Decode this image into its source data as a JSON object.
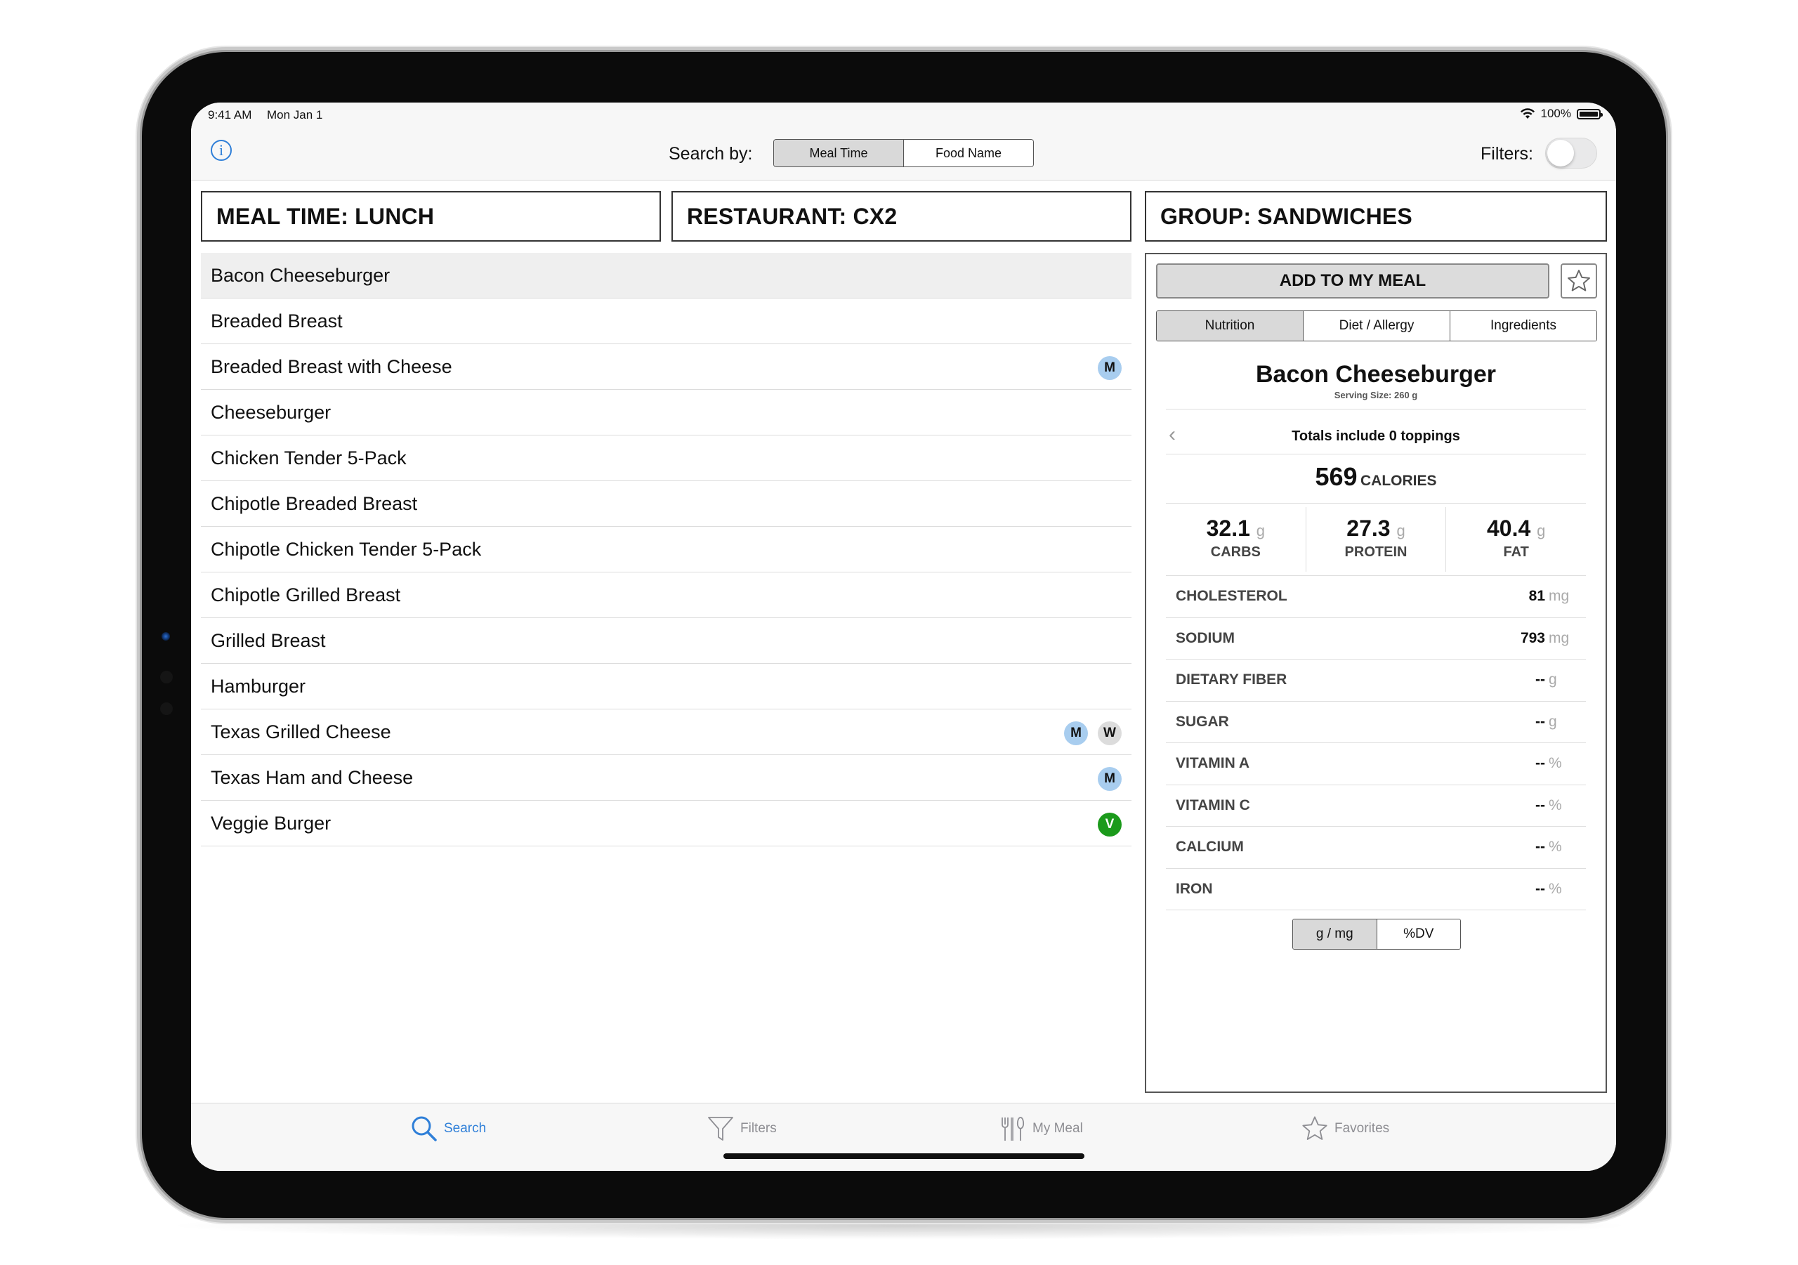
{
  "status_bar": {
    "time": "9:41 AM",
    "date": "Mon Jan 1",
    "battery": "100%"
  },
  "nav": {
    "search_by_label": "Search by:",
    "search_options": [
      "Meal Time",
      "Food Name"
    ],
    "selected_search_option": "Meal Time",
    "filters_label": "Filters:",
    "filters_enabled": false
  },
  "headers": {
    "meal_time": "MEAL TIME: LUNCH",
    "restaurant": "RESTAURANT: CX2",
    "group": "GROUP: SANDWICHES"
  },
  "food_list": [
    {
      "name": "Bacon Cheeseburger",
      "badges": [],
      "selected": true
    },
    {
      "name": "Breaded Breast",
      "badges": []
    },
    {
      "name": "Breaded Breast with Cheese",
      "badges": [
        "M"
      ]
    },
    {
      "name": "Cheeseburger",
      "badges": []
    },
    {
      "name": "Chicken Tender 5-Pack",
      "badges": []
    },
    {
      "name": "Chipotle Breaded Breast",
      "badges": []
    },
    {
      "name": "Chipotle Chicken Tender 5-Pack",
      "badges": []
    },
    {
      "name": "Chipotle Grilled Breast",
      "badges": []
    },
    {
      "name": "Grilled Breast",
      "badges": []
    },
    {
      "name": "Hamburger",
      "badges": []
    },
    {
      "name": "Texas Grilled Cheese",
      "badges": [
        "M",
        "W"
      ]
    },
    {
      "name": "Texas Ham and Cheese",
      "badges": [
        "M"
      ]
    },
    {
      "name": "Veggie Burger",
      "badges": [
        "V"
      ]
    }
  ],
  "detail": {
    "add_button": "ADD TO MY MEAL",
    "tabs": [
      "Nutrition",
      "Diet / Allergy",
      "Ingredients"
    ],
    "selected_tab": "Nutrition",
    "food_title": "Bacon Cheeseburger",
    "serving_size": "Serving Size: 260 g",
    "toppings": "Totals include 0 toppings",
    "calories": "569",
    "calories_label": "CALORIES",
    "macros": [
      {
        "value": "32.1",
        "unit": "g",
        "label": "CARBS"
      },
      {
        "value": "27.3",
        "unit": "g",
        "label": "PROTEIN"
      },
      {
        "value": "40.4",
        "unit": "g",
        "label": "FAT"
      }
    ],
    "nutrients": [
      {
        "name": "CHOLESTEROL",
        "value": "81",
        "unit": "mg"
      },
      {
        "name": "SODIUM",
        "value": "793",
        "unit": "mg"
      },
      {
        "name": "DIETARY FIBER",
        "value": "--",
        "unit": "g"
      },
      {
        "name": "SUGAR",
        "value": "--",
        "unit": "g"
      },
      {
        "name": "VITAMIN A",
        "value": "--",
        "unit": "%"
      },
      {
        "name": "VITAMIN C",
        "value": "--",
        "unit": "%"
      },
      {
        "name": "CALCIUM",
        "value": "--",
        "unit": "%"
      },
      {
        "name": "IRON",
        "value": "--",
        "unit": "%"
      }
    ],
    "unit_options": [
      "g / mg",
      "%DV"
    ],
    "selected_unit": "g / mg"
  },
  "tabbar": {
    "items": [
      {
        "label": "Search",
        "icon": "search-icon",
        "active": true
      },
      {
        "label": "Filters",
        "icon": "filter-icon",
        "active": false
      },
      {
        "label": "My Meal",
        "icon": "utensils-icon",
        "active": false
      },
      {
        "label": "Favorites",
        "icon": "star-icon",
        "active": false
      }
    ]
  },
  "colors": {
    "accent": "#2f7fd8",
    "badge_m": "#a8cdef",
    "badge_w": "#dcdcdc",
    "badge_v": "#1b9a1b"
  }
}
